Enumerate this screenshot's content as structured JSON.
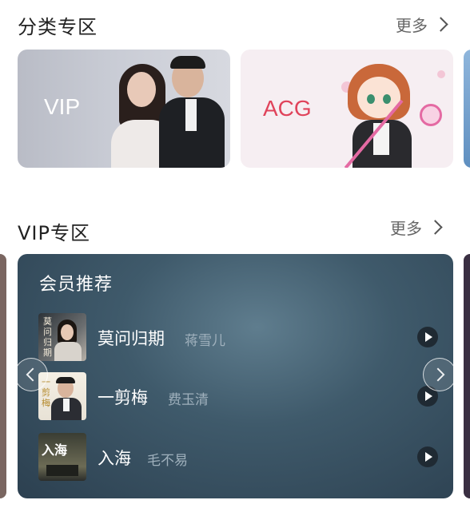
{
  "category": {
    "title": "分类专区",
    "more_label": "更多",
    "cards": [
      {
        "label": "VIP",
        "label_color": "#ffffff"
      },
      {
        "label": "ACG",
        "label_color": "#e0435b"
      }
    ]
  },
  "vip_section": {
    "title": "VIP专区",
    "more_label": "更多",
    "panel_title": "会员推荐",
    "songs": [
      {
        "name": "莫问归期",
        "artist": "蒋雪儿",
        "cover_text": "莫问归期"
      },
      {
        "name": "一剪梅",
        "artist": "费玉清",
        "cover_text": "一剪梅"
      },
      {
        "name": "入海",
        "artist": "毛不易",
        "cover_text": "入海"
      }
    ]
  },
  "colors": {
    "panel_bg": "#3f5a6b",
    "acg_accent": "#e0435b"
  }
}
